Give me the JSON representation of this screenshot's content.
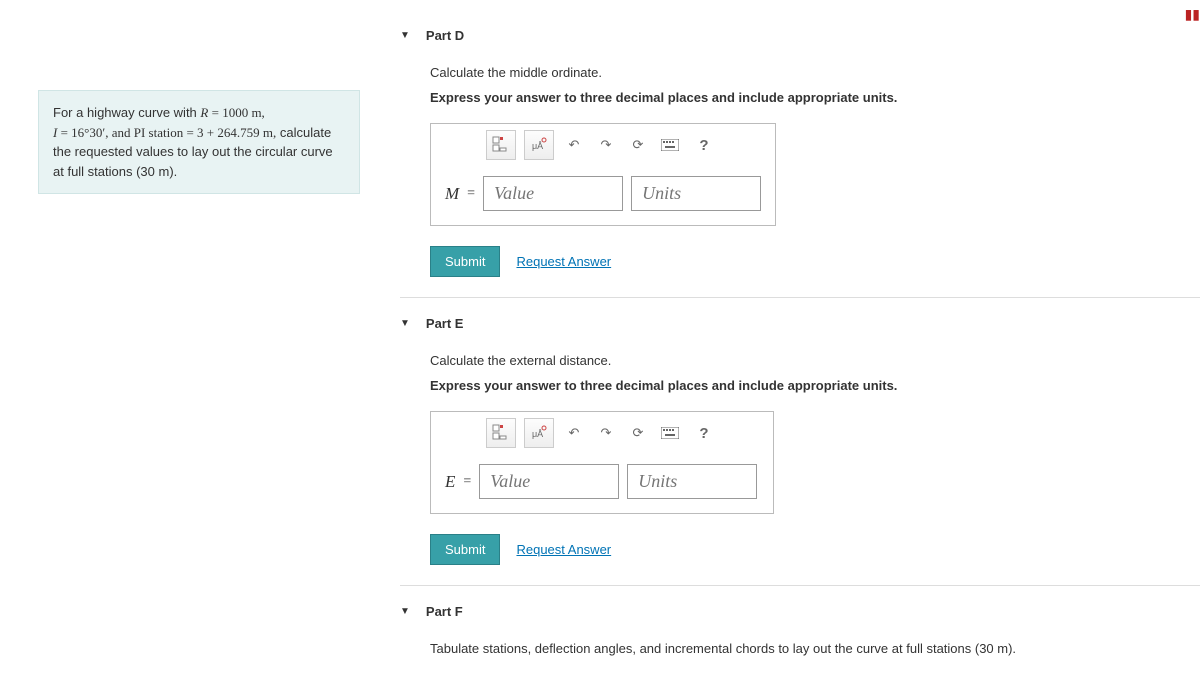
{
  "problem": {
    "line1_prefix": "For a highway curve with ",
    "line1_r": "R",
    "line1_eq1": " = 1000 m,",
    "line2_i": "I",
    "line2_eq2": " = 16°30′, and PI station = 3 + 264.759 m,",
    "line3": " calculate the requested values to lay out the circular curve at full stations (30 m)."
  },
  "parts": {
    "d": {
      "title": "Part D",
      "prompt": "Calculate the middle ordinate.",
      "hint": "Express your answer to three decimal places and include appropriate units.",
      "var": "M",
      "value_ph": "Value",
      "units_ph": "Units",
      "submit": "Submit",
      "request": "Request Answer"
    },
    "e": {
      "title": "Part E",
      "prompt": "Calculate the external distance.",
      "hint": "Express your answer to three decimal places and include appropriate units.",
      "var": "E",
      "value_ph": "Value",
      "units_ph": "Units",
      "submit": "Submit",
      "request": "Request Answer"
    },
    "f": {
      "title": "Part F",
      "prompt": "Tabulate stations, deflection angles, and incremental chords to lay out the curve at full stations (30 m)."
    }
  },
  "toolbar": {
    "help": "?"
  }
}
